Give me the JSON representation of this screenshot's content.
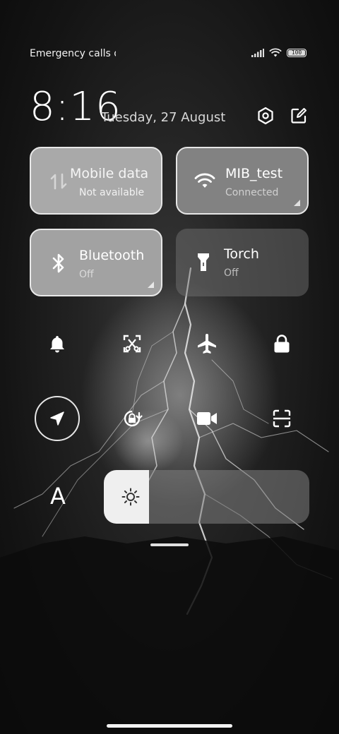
{
  "status_bar": {
    "carrier_text": "Emergency calls o",
    "battery_level": "100"
  },
  "header": {
    "time": "8:16",
    "date": "Tuesday, 27 August",
    "settings_icon": "hexagon-settings-icon",
    "edit_icon": "edit-icon"
  },
  "tiles": {
    "mobile_data": {
      "title": "Mobile data",
      "status": "Not available",
      "icon": "mobile-data-arrows-icon"
    },
    "wifi": {
      "title": "MIB_test",
      "status": "Connected",
      "icon": "wifi-icon"
    },
    "bluetooth": {
      "title": "Bluetooth",
      "status": "Off",
      "icon": "bluetooth-icon"
    },
    "torch": {
      "title": "Torch",
      "status": "Off",
      "icon": "torch-icon"
    }
  },
  "toggles": [
    {
      "name": "bell-icon",
      "active": false
    },
    {
      "name": "screenshot-icon",
      "active": false
    },
    {
      "name": "airplane-mode-icon",
      "active": false
    },
    {
      "name": "lock-icon",
      "active": false
    },
    {
      "name": "location-icon",
      "active": true
    },
    {
      "name": "auto-rotate-icon",
      "active": false
    },
    {
      "name": "screen-recorder-icon",
      "active": false
    },
    {
      "name": "scanner-icon",
      "active": false
    }
  ],
  "font_size_label": "A",
  "brightness": {
    "level": 0.22
  },
  "colors": {
    "tile_active_border": "#e8e8e8",
    "tile_inactive": "#787878"
  }
}
